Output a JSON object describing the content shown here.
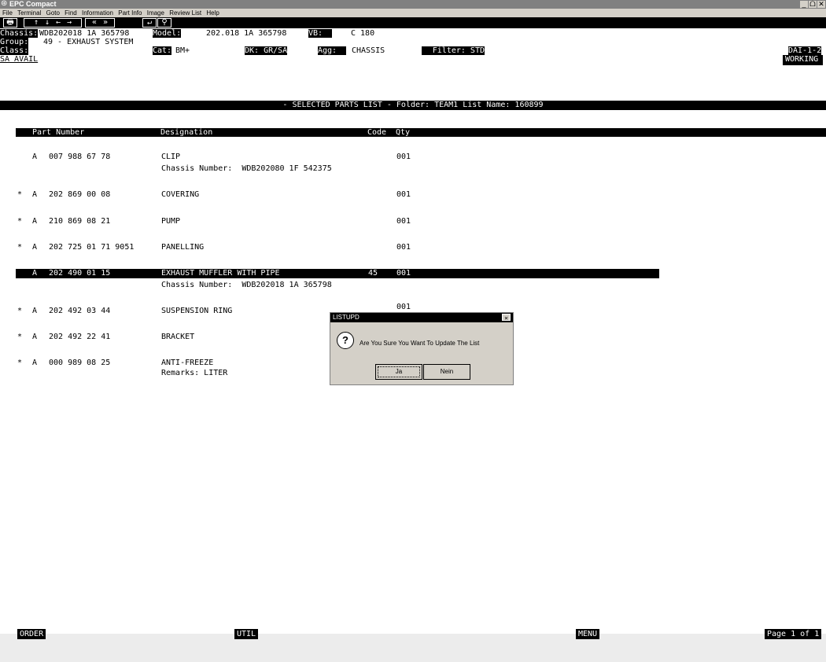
{
  "window": {
    "title": "EPC Compact",
    "buttons": [
      "_",
      "ᗝ",
      "✕"
    ]
  },
  "menu": [
    "File",
    "Terminal",
    "Goto",
    "Find",
    "Information",
    "Part Info",
    "Image",
    "Review List",
    "Help"
  ],
  "toolbar": {
    "buttons": [
      {
        "name": "print-icon",
        "glyph": "🖶"
      },
      {
        "name": "arrow-up-icon",
        "glyph": "↑"
      },
      {
        "name": "arrow-down-icon",
        "glyph": "↓"
      },
      {
        "name": "arrow-left-icon",
        "glyph": "←"
      },
      {
        "name": "arrow-right-icon",
        "glyph": "→"
      },
      {
        "name": "double-left-icon",
        "glyph": "«"
      },
      {
        "name": "double-right-icon",
        "glyph": "»"
      },
      {
        "name": "enter-icon",
        "glyph": "↵"
      },
      {
        "name": "search-icon",
        "glyph": "⚲"
      }
    ]
  },
  "header": {
    "chassis_label": "Chassis:",
    "chassis_value": "WDB202018 1A 365798",
    "model_label": "Model:",
    "model_value": "202.018 1A 365798",
    "vb_label": "VB:",
    "vb_value": "C 180",
    "group_label": "Group:",
    "group_value": "49 - EXHAUST SYSTEM",
    "class_label": "Class:",
    "cat_label": "Cat:",
    "cat_value": "BM+",
    "dk_label": "DK: GR/SA",
    "agg_label": "Agg:",
    "agg_value": "CHASSIS",
    "filter_label": "Filter: STD",
    "dai": "DAI-1-2",
    "sa_avail": "SA AVAIL",
    "working": "WORKING"
  },
  "banner": "- SELECTED PARTS LIST - Folder: TEAM1 List Name: 160899",
  "columns": {
    "part_number": "Part Number",
    "designation": "Designation",
    "code": "Code",
    "qty": "Qty"
  },
  "parts": [
    {
      "mark": "",
      "prefix": "A",
      "number": "007 988 67 78",
      "designation": "CLIP",
      "code": "",
      "qty": "001",
      "sub": "Chassis Number:  WDB202080 1F 542375"
    },
    {
      "mark": "*",
      "prefix": "A",
      "number": "202 869 00 08",
      "designation": "COVERING",
      "code": "",
      "qty": "001",
      "sub": ""
    },
    {
      "mark": "*",
      "prefix": "A",
      "number": "210 869 08 21",
      "designation": "PUMP",
      "code": "",
      "qty": "001",
      "sub": ""
    },
    {
      "mark": "*",
      "prefix": "A",
      "number": "202 725 01 71 9051",
      "designation": "PANELLING",
      "code": "",
      "qty": "001",
      "sub": ""
    },
    {
      "mark": "",
      "prefix": "A",
      "number": "202 490 01 15",
      "designation": "EXHAUST MUFFLER WITH PIPE",
      "code": "45",
      "qty": "001",
      "sub": "Chassis Number:  WDB202018 1A 365798",
      "selected": true
    },
    {
      "mark": "*",
      "prefix": "A",
      "number": "202 492 03 44",
      "designation": "SUSPENSION RING",
      "code": "",
      "qty": "001",
      "sub": ""
    },
    {
      "mark": "*",
      "prefix": "A",
      "number": "202 492 22 41",
      "designation": "BRACKET",
      "code": "",
      "qty": "",
      "sub": ""
    },
    {
      "mark": "*",
      "prefix": "A",
      "number": "000 989 08 25",
      "designation": "ANTI-FREEZE",
      "code": "",
      "qty": "",
      "sub": "Remarks: LITER"
    }
  ],
  "dialog": {
    "title": "LISTUPD",
    "message": "Are You Sure You Want To Update The List",
    "yes": "Ja",
    "no": "Nein"
  },
  "footer": {
    "order": "ORDER",
    "util": "UTIL",
    "menu": "MENU",
    "page": "Page 1 of 1"
  }
}
